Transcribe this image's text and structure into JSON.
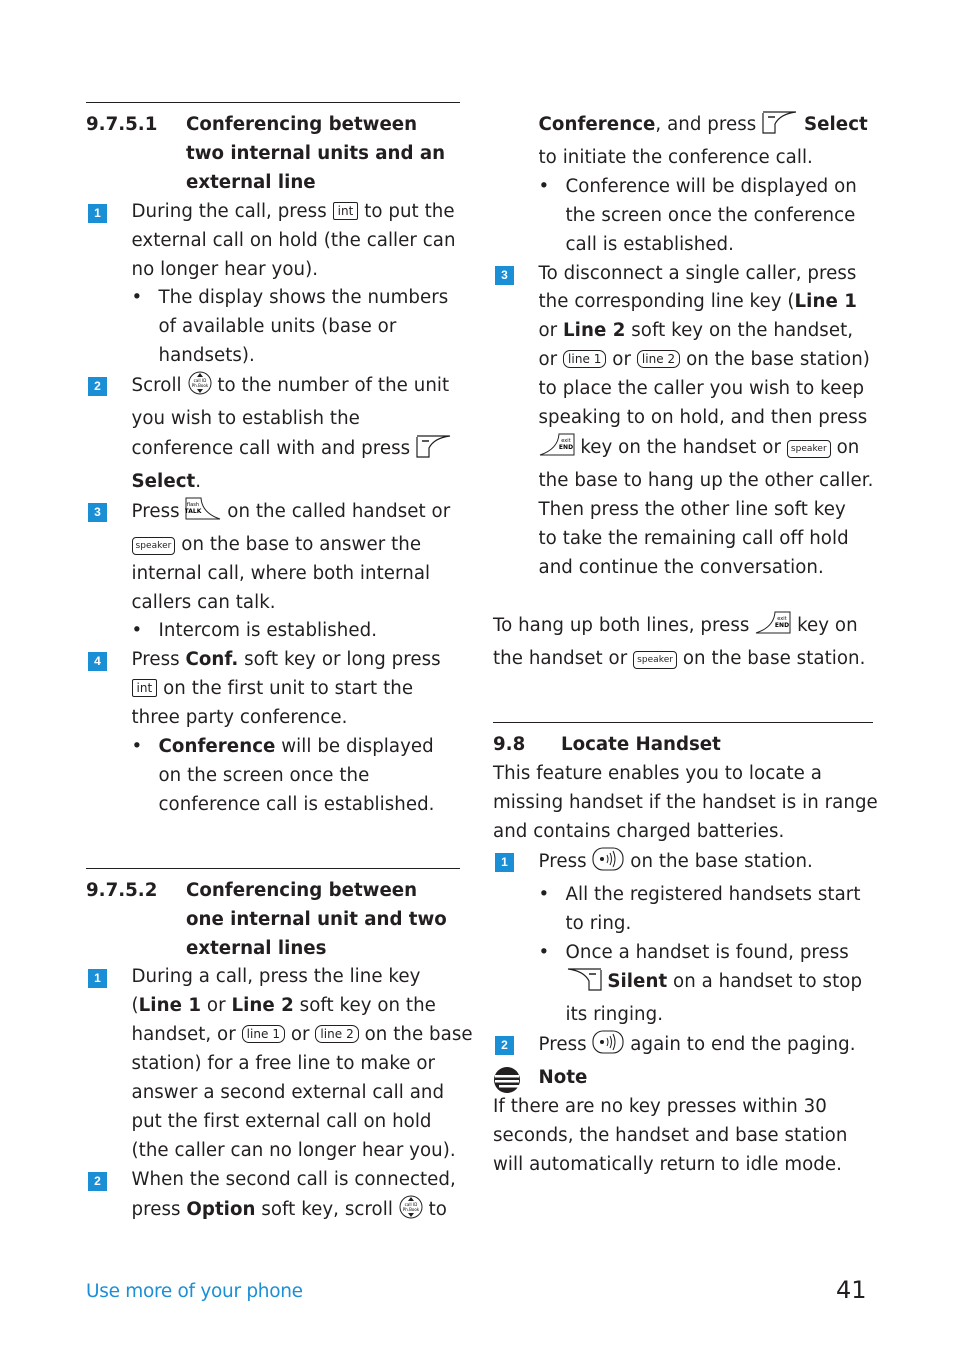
{
  "section_9_7_5_1": {
    "number": "9.7.5.1",
    "title_lines": [
      "Conferencing between",
      "two internal units and an",
      "external line"
    ],
    "step1": {
      "num": "1",
      "l1a": "During the call, press ",
      "key": "int",
      "l1b": " to put the",
      "l2": "external call on hold (the caller can",
      "l3": "no longer hear you).",
      "bullet": [
        "The display shows the numbers",
        "of available units (base or",
        "handsets)."
      ]
    },
    "step2": {
      "num": "2",
      "l1a": "Scroll ",
      "l1b": " to the number of the unit",
      "l2": "you wish to establish the",
      "l3": "conference call with and press ",
      "l4_bold": "Select",
      "l4_end": "."
    },
    "step3": {
      "num": "3",
      "l1a": "Press ",
      "l1b": " on the called handset or",
      "key": "speaker",
      "l2b": " on the base to answer the",
      "l3": "internal call, where both internal",
      "l4": "callers can talk.",
      "bullet": [
        "Intercom is established."
      ]
    },
    "step4": {
      "num": "4",
      "l1a": "Press ",
      "l1_bold": "Conf.",
      "l1b": " soft key or long press",
      "key": "int",
      "l2b": " on the first unit to start the",
      "l3": "three party conference.",
      "bullet_bold": "Conference",
      "bullet_l1": " will be displayed",
      "bullet_l2": "on the screen once the",
      "bullet_l3": "conference call is established."
    }
  },
  "section_9_7_5_2": {
    "number": "9.7.5.2",
    "title_lines": [
      "Conferencing between",
      "one internal unit and two",
      "external lines"
    ],
    "step1": {
      "num": "1",
      "l1": "During a call, press the line key",
      "l2a": "(",
      "l2_bold1": "Line 1",
      "l2b": " or ",
      "l2_bold2": "Line 2",
      "l2c": " soft key on the",
      "l3a": "handset, or ",
      "key1": "line 1",
      "l3b": " or ",
      "key2": "line 2",
      "l3c": " on the base",
      "l4": "station) for a free line to make or",
      "l5": "answer a second external call and",
      "l6": "put the first external call on hold",
      "l7": "(the caller can no longer hear you)."
    },
    "step2": {
      "num": "2",
      "l1": "When the second call is connected,",
      "l2a": "press ",
      "l2_bold": "Option",
      "l2b": " soft key, scroll ",
      "l2c": " to",
      "l3_bold": "Conference",
      "l3a": ", and press ",
      "l3_bold2": "Select",
      "l4": "to initiate the conference call.",
      "bullet": [
        "Conference will be displayed on",
        "the screen once the conference",
        "call is established."
      ]
    },
    "step3": {
      "num": "3",
      "l1": "To disconnect a single caller, press",
      "l2a": "the corresponding line key (",
      "l2_bold": "Line 1",
      "l3_bold": "Line 2",
      "l3a": "or ",
      "l3b": " soft key on the handset,",
      "l4a": "or ",
      "key1": "line 1",
      "l4b": " or ",
      "key2": "line 2",
      "l4c": " on the base station)",
      "l5": "to place the caller you wish to keep",
      "l6": "speaking to on hold, and then press",
      "l7b": " key on the handset or ",
      "key3": "speaker",
      "l7c": " on",
      "l8": "the base to hang up the other caller.",
      "l9": "Then press the other line soft key",
      "l10": "to take the remaining call off hold",
      "l11": "and continue the conversation."
    },
    "hangup": {
      "l1a": "To hang up both lines, press ",
      "l1b": " key on",
      "l2a": "the handset or ",
      "key": "speaker",
      "l2b": " on the base station."
    }
  },
  "section_9_8": {
    "number": "9.8",
    "title": "Locate Handset",
    "intro": [
      "This feature enables you to locate a",
      "missing handset if the handset is in range",
      "and contains charged batteries."
    ],
    "step1": {
      "num": "1",
      "l1a": "Press ",
      "l1b": " on the base station.",
      "bullet1": [
        "All the registered handsets start",
        "to ring."
      ],
      "bullet2_l1": "Once a handset is found, press",
      "bullet2_bold": "Silent",
      "bullet2_l2": " on a handset to stop",
      "bullet2_l3": "its ringing."
    },
    "step2": {
      "num": "2",
      "l1a": "Press ",
      "l1b": " again to end the paging."
    },
    "note": {
      "label": "Note",
      "lines": [
        "If there are no key presses within 30",
        "seconds, the handset and base station",
        "will automatically return to idle mode."
      ]
    }
  },
  "footer": {
    "section": "Use more of your phone",
    "page": "41"
  },
  "icon_labels": {
    "talk_top": "flash",
    "talk_bottom": "TALK",
    "end_top": "exit",
    "end_bottom": "END",
    "nav_top": "call ID",
    "nav_bottom": "Ph.Book"
  },
  "colors": {
    "accent": "#1a8fd6",
    "text": "#231f20"
  }
}
